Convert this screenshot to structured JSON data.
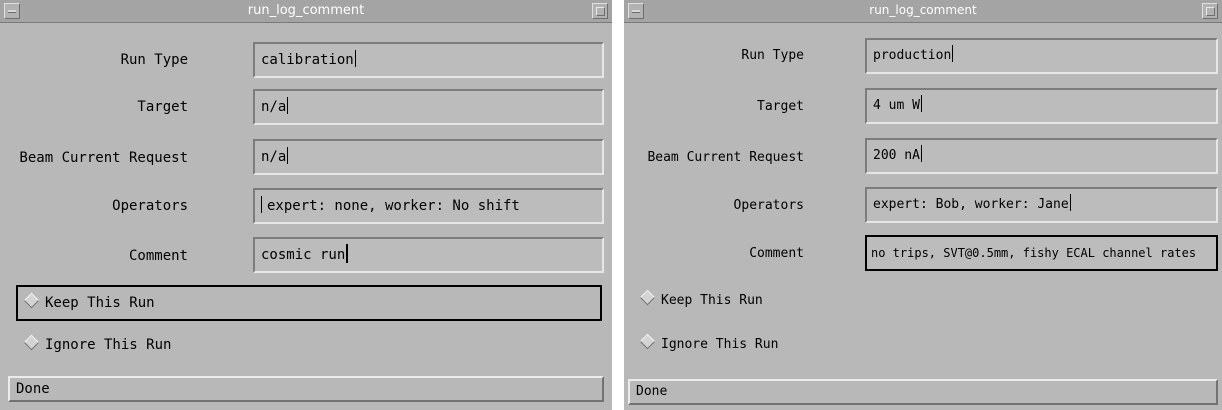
{
  "windows": [
    {
      "title": "run_log_comment",
      "fields": [
        {
          "label": "Run Type",
          "value": "calibration"
        },
        {
          "label": "Target",
          "value": "n/a"
        },
        {
          "label": "Beam Current Request",
          "value": "n/a"
        },
        {
          "label": "Operators",
          "value": "expert: none, worker: No shift"
        },
        {
          "label": "Comment",
          "value": "cosmic run"
        }
      ],
      "options": [
        {
          "label": "Keep This Run"
        },
        {
          "label": "Ignore This Run"
        }
      ],
      "done_label": "Done"
    },
    {
      "title": "run_log_comment",
      "fields": [
        {
          "label": "Run Type",
          "value": "production"
        },
        {
          "label": "Target",
          "value": "4 um W"
        },
        {
          "label": "Beam Current Request",
          "value": "200 nA"
        },
        {
          "label": "Operators",
          "value": "expert: Bob, worker: Jane"
        },
        {
          "label": "Comment",
          "value": "no trips, SVT@0.5mm, fishy ECAL channel rates"
        }
      ],
      "options": [
        {
          "label": "Keep This Run"
        },
        {
          "label": "Ignore This Run"
        }
      ],
      "done_label": "Done"
    }
  ]
}
